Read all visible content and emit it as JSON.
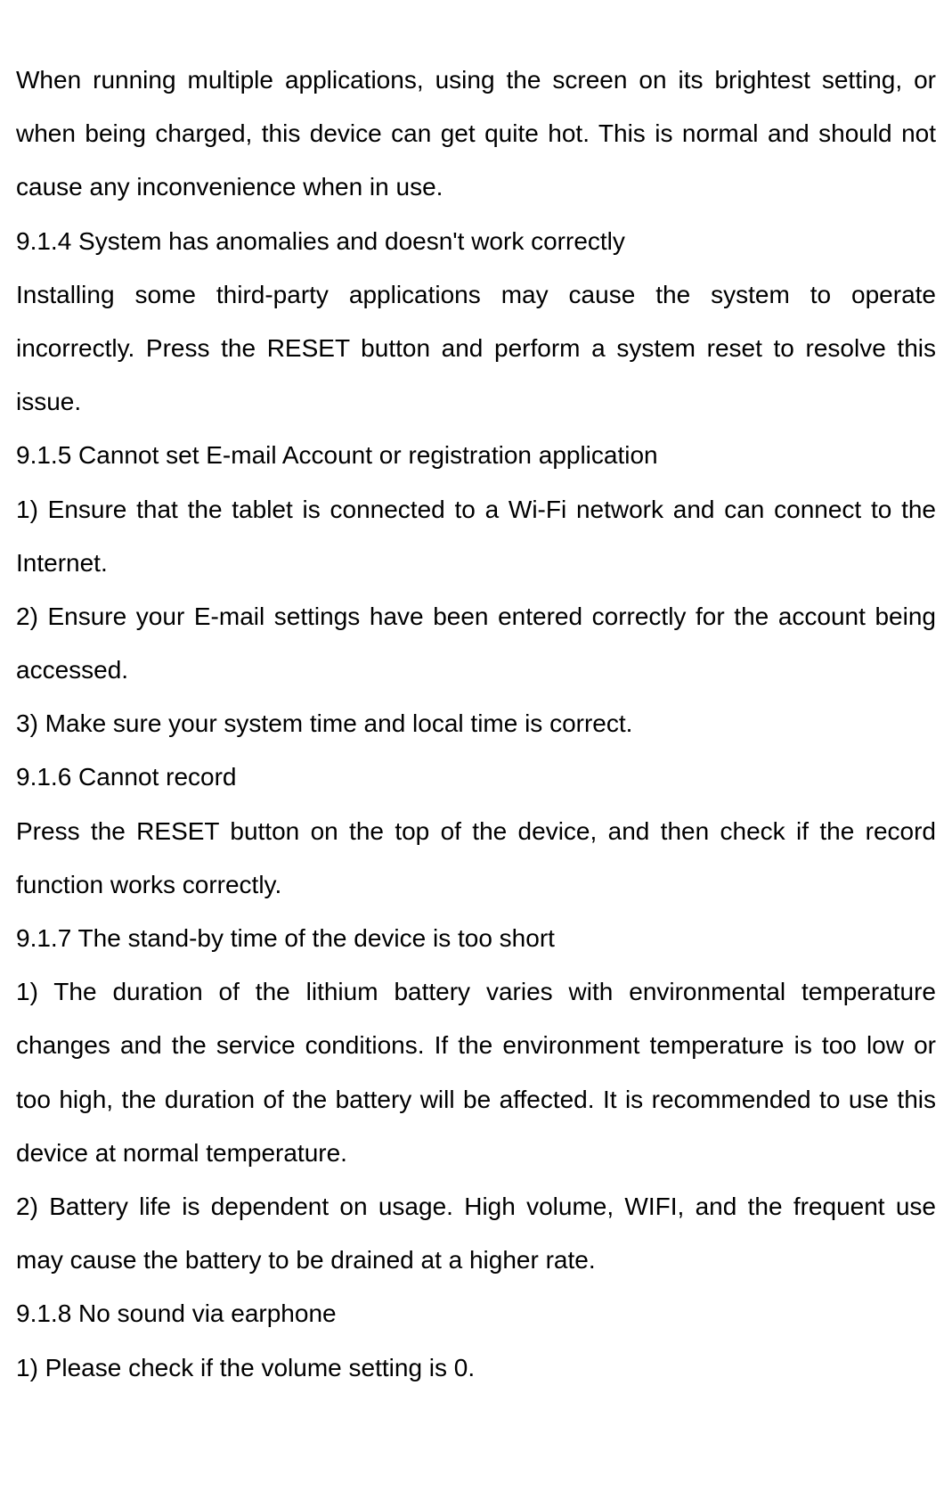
{
  "sections": {
    "intro": "When running multiple applications, using the screen on its brightest setting, or when being charged, this device can get quite hot. This is normal and should not cause any inconvenience when in use.",
    "s914_title": "9.1.4 System has anomalies and doesn't work correctly",
    "s914_body": "Installing some third-party applications may cause the system to operate incorrectly. Press the RESET button and perform a system reset to resolve this issue.",
    "s915_title": "9.1.5 Cannot set E-mail Account or registration application",
    "s915_item1": "1) Ensure that the tablet is connected to a Wi-Fi network and can connect to the Internet.",
    "s915_item2": "2) Ensure your E-mail settings have been entered correctly for the account being accessed.",
    "s915_item3": "3) Make sure your system time and local time is correct.",
    "s916_title": "9.1.6 Cannot record",
    "s916_body": "Press the RESET button on the top of the device, and then check if the record function works correctly.",
    "s917_title": "9.1.7 The stand-by time of the device is too short",
    "s917_item1": "1) The duration of the lithium battery varies with environmental temperature changes and the service conditions. If the environment temperature is too low or too high, the duration of the battery will be affected. It is recommended to use this device at normal temperature.",
    "s917_item2": "2) Battery life is dependent on usage. High volume, WIFI, and the frequent use may cause the battery to be drained at a higher rate.",
    "s918_title": "9.1.8 No sound via earphone",
    "s918_item1": "1) Please check if the volume setting is 0."
  }
}
